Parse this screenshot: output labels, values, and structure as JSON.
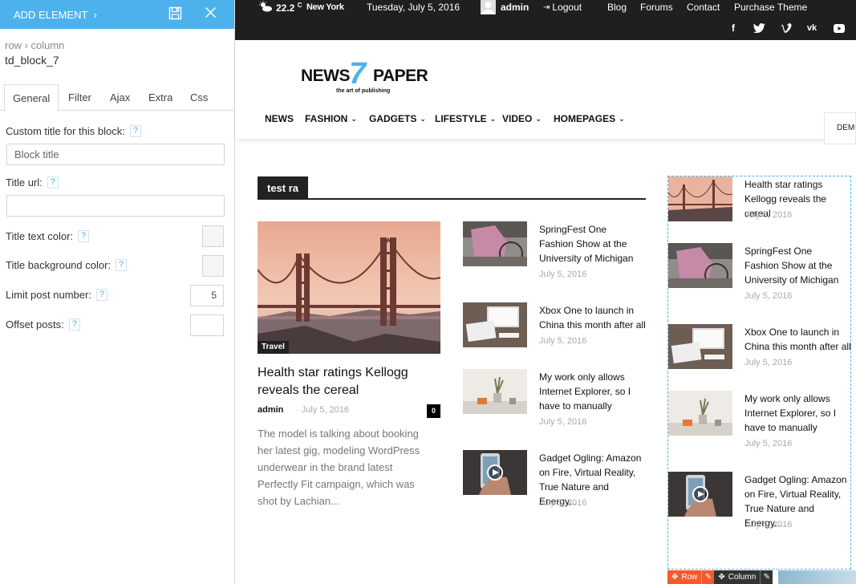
{
  "panel": {
    "add_element": "ADD ELEMENT",
    "breadcrumb": "row › column",
    "block_name": "td_block_7",
    "tabs": [
      "General",
      "Filter",
      "Ajax",
      "Extra",
      "Css"
    ],
    "active_tab": "General",
    "help": "?",
    "fields": {
      "custom_title_label": "Custom title for this block:",
      "custom_title_value": "Block title",
      "title_url_label": "Title url:",
      "title_url_value": "",
      "title_text_color_label": "Title text color:",
      "title_bg_color_label": "Title background color:",
      "limit_label": "Limit post number:",
      "limit_value": "5",
      "offset_label": "Offset posts:",
      "offset_value": ""
    }
  },
  "topbar": {
    "temperature": "22.2",
    "temp_unit": "C",
    "city": "New York",
    "date": "Tuesday, July 5, 2016",
    "user": "admin",
    "logout": "Logout",
    "links": [
      "Blog",
      "Forums",
      "Contact",
      "Purchase Theme"
    ],
    "social_icons": [
      "facebook-icon",
      "twitter-icon",
      "vimeo-icon",
      "vk-icon",
      "youtube-icon"
    ]
  },
  "logo": {
    "part1": "NEWS",
    "part2": "7",
    "part3": "PAPER",
    "tagline": "the art of publishing"
  },
  "menu": [
    "NEWS",
    "FASHION",
    "GADGETS",
    "LIFESTYLE",
    "VIDEO",
    "HOMEPAGES"
  ],
  "demos_label": "DEMOS",
  "block": {
    "title": "test ra",
    "featured": {
      "category": "Travel",
      "title": "Health star ratings Kellogg reveals the cereal",
      "author": "admin",
      "date": "July 5, 2016",
      "comments": "0",
      "excerpt": "The model is talking about booking her latest gig, modeling WordPress underwear in the brand latest Perfectly Fit campaign, which was shot by Lachian..."
    },
    "list": [
      {
        "title": "SpringFest One Fashion Show at the University of Michigan",
        "date": "July 5, 2016"
      },
      {
        "title": "Xbox One to launch in China this month after all",
        "date": "July 5, 2016"
      },
      {
        "title": "My work only allows Internet Explorer, so I have to manually",
        "date": "July 5, 2016"
      },
      {
        "title": "Gadget Ogling: Amazon on Fire, Virtual Reality, True Nature and Energy...",
        "date": "July 5, 2016"
      }
    ]
  },
  "sidebar": [
    {
      "title": "Health star ratings Kellogg reveals the cereal",
      "date": "July 5, 2016"
    },
    {
      "title": "SpringFest One Fashion Show at the University of Michigan",
      "date": "July 5, 2016"
    },
    {
      "title": "Xbox One to launch in China this month after all",
      "date": "July 5, 2016"
    },
    {
      "title": "My work only allows Internet Explorer, so I have to manually",
      "date": "July 5, 2016"
    },
    {
      "title": "Gadget Ogling: Amazon on Fire, Virtual Reality, True Nature and Energy...",
      "date": "July 5, 2016"
    }
  ],
  "builder_bar": {
    "row": "Row",
    "column": "Column"
  },
  "colors": {
    "accent": "#4db2ec",
    "topbar": "#1f1f1f",
    "row_bar": "#f45a2a"
  }
}
